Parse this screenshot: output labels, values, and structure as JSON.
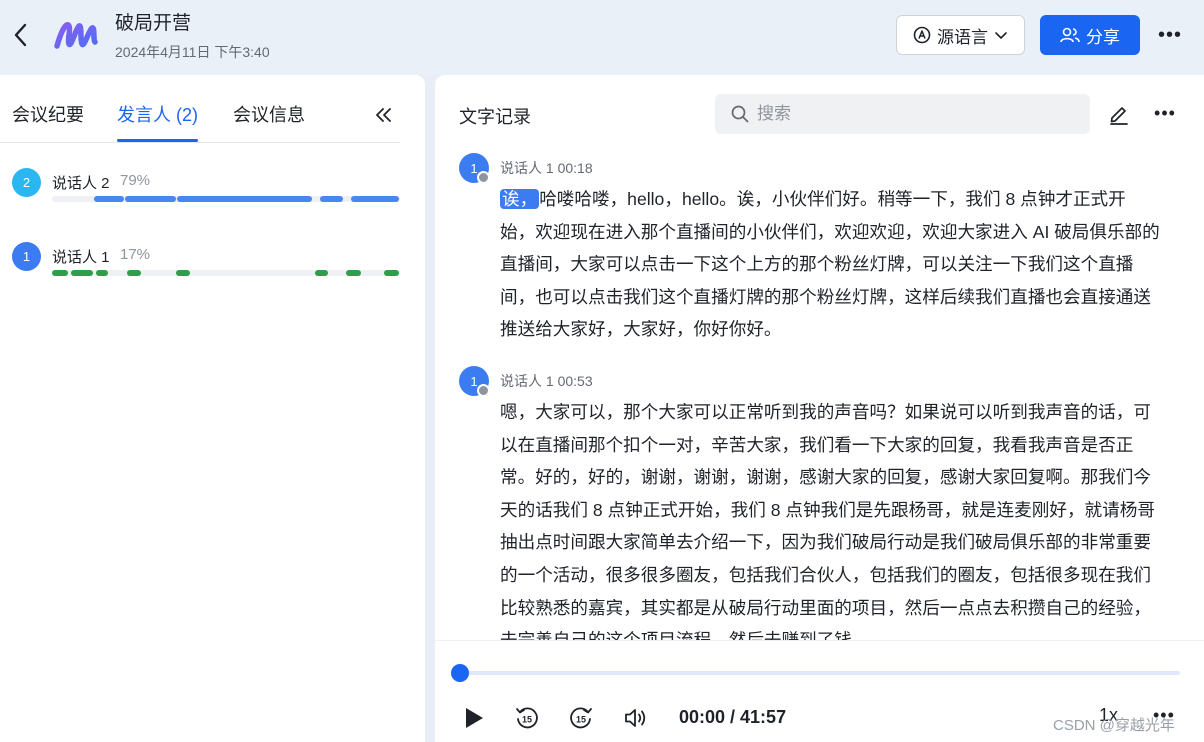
{
  "header": {
    "title": "破局开营",
    "datetime": "2024年4月11日 下午3:40",
    "lang_label": "源语言",
    "share_label": "分享"
  },
  "left_tabs": [
    {
      "label": "会议纪要"
    },
    {
      "label": "发言人 (2)"
    },
    {
      "label": "会议信息"
    }
  ],
  "speakers": [
    {
      "avatar": "2",
      "name": "说话人 2",
      "percent": "79%",
      "color": "#2ab6f0",
      "bar_color": "#4a86ef",
      "segments": [
        [
          0.12,
          0.21
        ],
        [
          0.21,
          0.36
        ],
        [
          0.36,
          0.75
        ],
        [
          0.77,
          0.84
        ],
        [
          0.86,
          1.0
        ]
      ]
    },
    {
      "avatar": "1",
      "name": "说话人 1",
      "percent": "17%",
      "color": "#3b7cf0",
      "bar_color": "#2e9e4a",
      "segments": [
        [
          0.0,
          0.05
        ],
        [
          0.055,
          0.12
        ],
        [
          0.125,
          0.165
        ],
        [
          0.215,
          0.26
        ],
        [
          0.355,
          0.4
        ],
        [
          0.755,
          0.795
        ],
        [
          0.845,
          0.89
        ],
        [
          0.955,
          1.0
        ]
      ]
    }
  ],
  "transcript": {
    "title": "文字记录",
    "search_placeholder": "搜索",
    "entries": [
      {
        "avatar": "1",
        "meta": "说话人 1  00:18",
        "highlight": "诶，",
        "text": "哈喽哈喽，hello，hello。诶，小伙伴们好。稍等一下，我们 8 点钟才正式开始，欢迎现在进入那个直播间的小伙伴们，欢迎欢迎，欢迎大家进入 AI 破局俱乐部的直播间，大家可以点击一下这个上方的那个粉丝灯牌，可以关注一下我们这个直播间，也可以点击我们这个直播灯牌的那个粉丝灯牌，这样后续我们直播也会直接通送推送给大家好，大家好，你好你好。"
      },
      {
        "avatar": "1",
        "meta": "说话人 1  00:53",
        "highlight": "",
        "text": "嗯，大家可以，那个大家可以正常听到我的声音吗？如果说可以听到我声音的话，可以在直播间那个扣个一对，辛苦大家，我们看一下大家的回复，我看我声音是否正常。好的，好的，谢谢，谢谢，谢谢，感谢大家的回复，感谢大家回复啊。那我们今天的话我们 8 点钟正式开始，我们 8 点钟我们是先跟杨哥，就是连麦刚好，就请杨哥抽出点时间跟大家简单去介绍一下，因为我们破局行动是我们破局俱乐部的非常重要的一个活动，很多很多圈友，包括我们合伙人，包括我们的圈友，包括很多现在我们比较熟悉的嘉宾，其实都是从破局行动里面的项目，然后一点点去积攒自己的经验，去完善自己的这个项目流程，然后去赚到了钱。"
      }
    ]
  },
  "player": {
    "progress": 0,
    "time": "00:00 / 41:57",
    "speed": "1x"
  },
  "watermark": "CSDN @穿越光年",
  "colors": {
    "accent": "#1a66f2",
    "bg": "#e9eef6"
  }
}
